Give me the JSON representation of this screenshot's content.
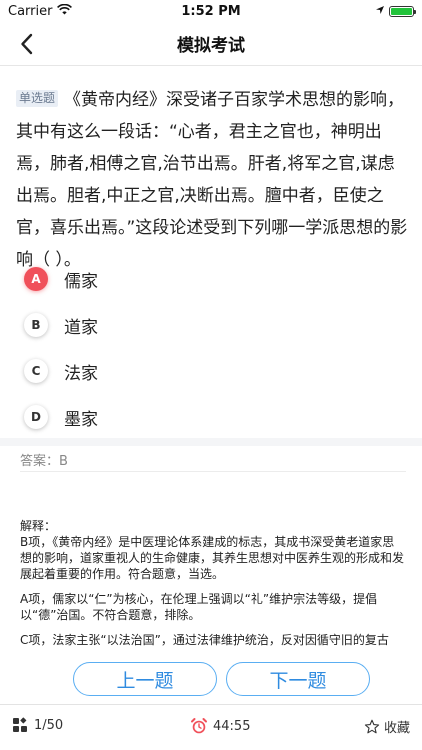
{
  "status": {
    "carrier": "Carrier",
    "time": "1:52 PM",
    "battery_level": 1.0
  },
  "nav": {
    "title": "模拟考试"
  },
  "question": {
    "type": "单选题",
    "text": "《黄帝内经》深受诸子百家学术思想的影响，其中有这么一段话：“心者，君主之官也，神明出焉，肺者,相傅之官,治节出焉。肝者,将军之官,谋虑出焉。胆者,中正之官,决断出焉。膻中者，臣使之官，喜乐出焉。”这段论述受到下列哪一学派思想的影响（   ）。"
  },
  "options": [
    {
      "letter": "A",
      "text": "儒家",
      "selected": true
    },
    {
      "letter": "B",
      "text": "道家",
      "selected": false
    },
    {
      "letter": "C",
      "text": "法家",
      "selected": false
    },
    {
      "letter": "D",
      "text": "墨家",
      "selected": false
    }
  ],
  "answer": {
    "text": "答案：B"
  },
  "explanation": {
    "title": "解释：",
    "paragraphs": [
      "B项，《黄帝内经》是中医理论体系建成的标志，其成书深受黄老道家思想的影响，道家重视人的生命健康，其养生思想对中医养生观的形成和发展起着重要的作用。符合题意，当选。",
      "A项，儒家以“仁”为核心，在伦理上强调以“礼”维护宗法等级，提倡以“德”治国。不符合题意，排除。",
      "C项，法家主张“以法治国”，通过法律维护统治，反对因循守旧的复古"
    ]
  },
  "buttons": {
    "prev": "上一题",
    "next": "下一题"
  },
  "bottom": {
    "progress": "1/50",
    "timer": "44:55",
    "favorite": "收藏"
  },
  "colors": {
    "accent": "#2f8be0",
    "selected": "#f0505a",
    "timer_icon": "#f0505a"
  }
}
